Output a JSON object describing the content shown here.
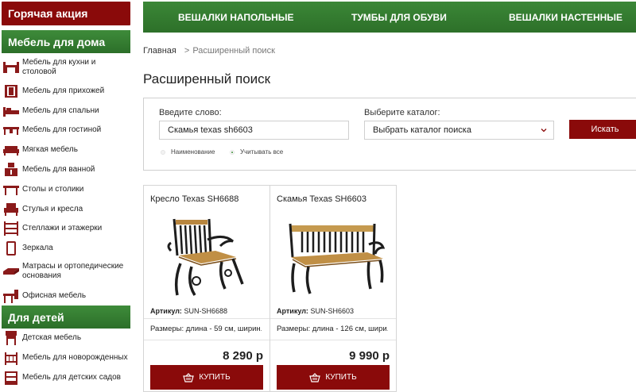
{
  "sidebar": {
    "hot_label": "Горячая акция",
    "home_section": {
      "title": "Мебель для дома",
      "items": [
        {
          "label": "Мебель для кухни и\nстоловой",
          "icon": "kitchen-icon"
        },
        {
          "label": "Мебель для прихожей",
          "icon": "hallway-icon"
        },
        {
          "label": "Мебель для спальни",
          "icon": "bed-icon"
        },
        {
          "label": "Мебель для гостиной",
          "icon": "living-room-icon"
        },
        {
          "label": "Мягкая мебель",
          "icon": "sofa-icon"
        },
        {
          "label": "Мебель для ванной",
          "icon": "bathroom-icon"
        },
        {
          "label": "Столы и столики",
          "icon": "table-icon"
        },
        {
          "label": "Стулья и кресла",
          "icon": "armchair-icon"
        },
        {
          "label": "Стеллажи и этажерки",
          "icon": "shelf-icon"
        },
        {
          "label": "Зеркала",
          "icon": "mirror-icon"
        },
        {
          "label": "Матрасы и ортопедические\nоснования",
          "icon": "mattress-icon"
        },
        {
          "label": "Офисная мебель",
          "icon": "office-icon"
        }
      ]
    },
    "kids_section": {
      "title": "Для детей",
      "items": [
        {
          "label": "Детская мебель",
          "icon": "kids-furniture-icon"
        },
        {
          "label": "Мебель для новорожденных",
          "icon": "crib-icon"
        },
        {
          "label": "Мебель для детских садов",
          "icon": "kindergarten-icon"
        }
      ]
    }
  },
  "topnav": [
    "ВЕШАЛКИ НАПОЛЬНЫЕ",
    "ТУМБЫ ДЛЯ ОБУВИ",
    "ВЕШАЛКИ НАСТЕННЫЕ"
  ],
  "breadcrumb": {
    "home": "Главная",
    "separator": ">",
    "current": "Расширенный поиск"
  },
  "page_title": "Расширенный поиск",
  "search": {
    "word_label": "Введите слово:",
    "word_value": "Скамья texas sh6603",
    "catalog_label": "Выберите каталог:",
    "catalog_value": "Выбрать каталог поиска",
    "button": "Искать",
    "radio_name": "Наименование",
    "radio_all": "Учитывать все"
  },
  "products": [
    {
      "name": "Кресло Texas SH6688",
      "sku_label": "Артикул:",
      "sku": "SUN-SH6688",
      "size": "Размеры: длина - 59 см, ширин...",
      "price": "8 290 р",
      "buy": "КУПИТЬ"
    },
    {
      "name": "Скамья Texas SH6603",
      "sku_label": "Артикул:",
      "sku": "SUN-SH6603",
      "size": "Размеры: длина - 126 см, шири...",
      "price": "9 990 р",
      "buy": "КУПИТЬ"
    }
  ],
  "colors": {
    "brand_red": "#8a0a0a",
    "brand_green": "#2f742b",
    "radio_active": "#3a8a36"
  }
}
